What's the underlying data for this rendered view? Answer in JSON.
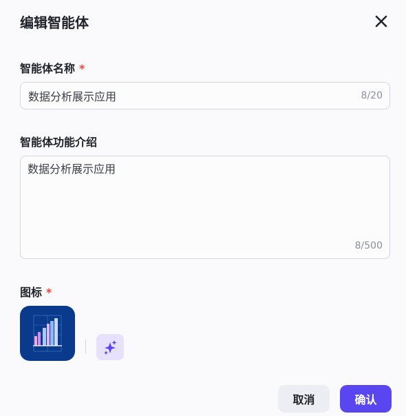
{
  "dialog": {
    "title": "编辑智能体"
  },
  "name_field": {
    "label": "智能体名称",
    "required_mark": "*",
    "value": "数据分析展示应用",
    "counter": "8/20"
  },
  "desc_field": {
    "label": "智能体功能介绍",
    "value": "数据分析展示应用",
    "counter": "8/500"
  },
  "icon_field": {
    "label": "图标",
    "required_mark": "*",
    "icon_name": "bar-chart-icon",
    "magic_icon_name": "sparkle-icon"
  },
  "buttons": {
    "cancel": "取消",
    "confirm": "确认"
  },
  "colors": {
    "primary": "#5a46f0",
    "required": "#f04438",
    "icon_tile_bg": "#0a3a8c",
    "magic_bg": "#e7e1fb"
  }
}
